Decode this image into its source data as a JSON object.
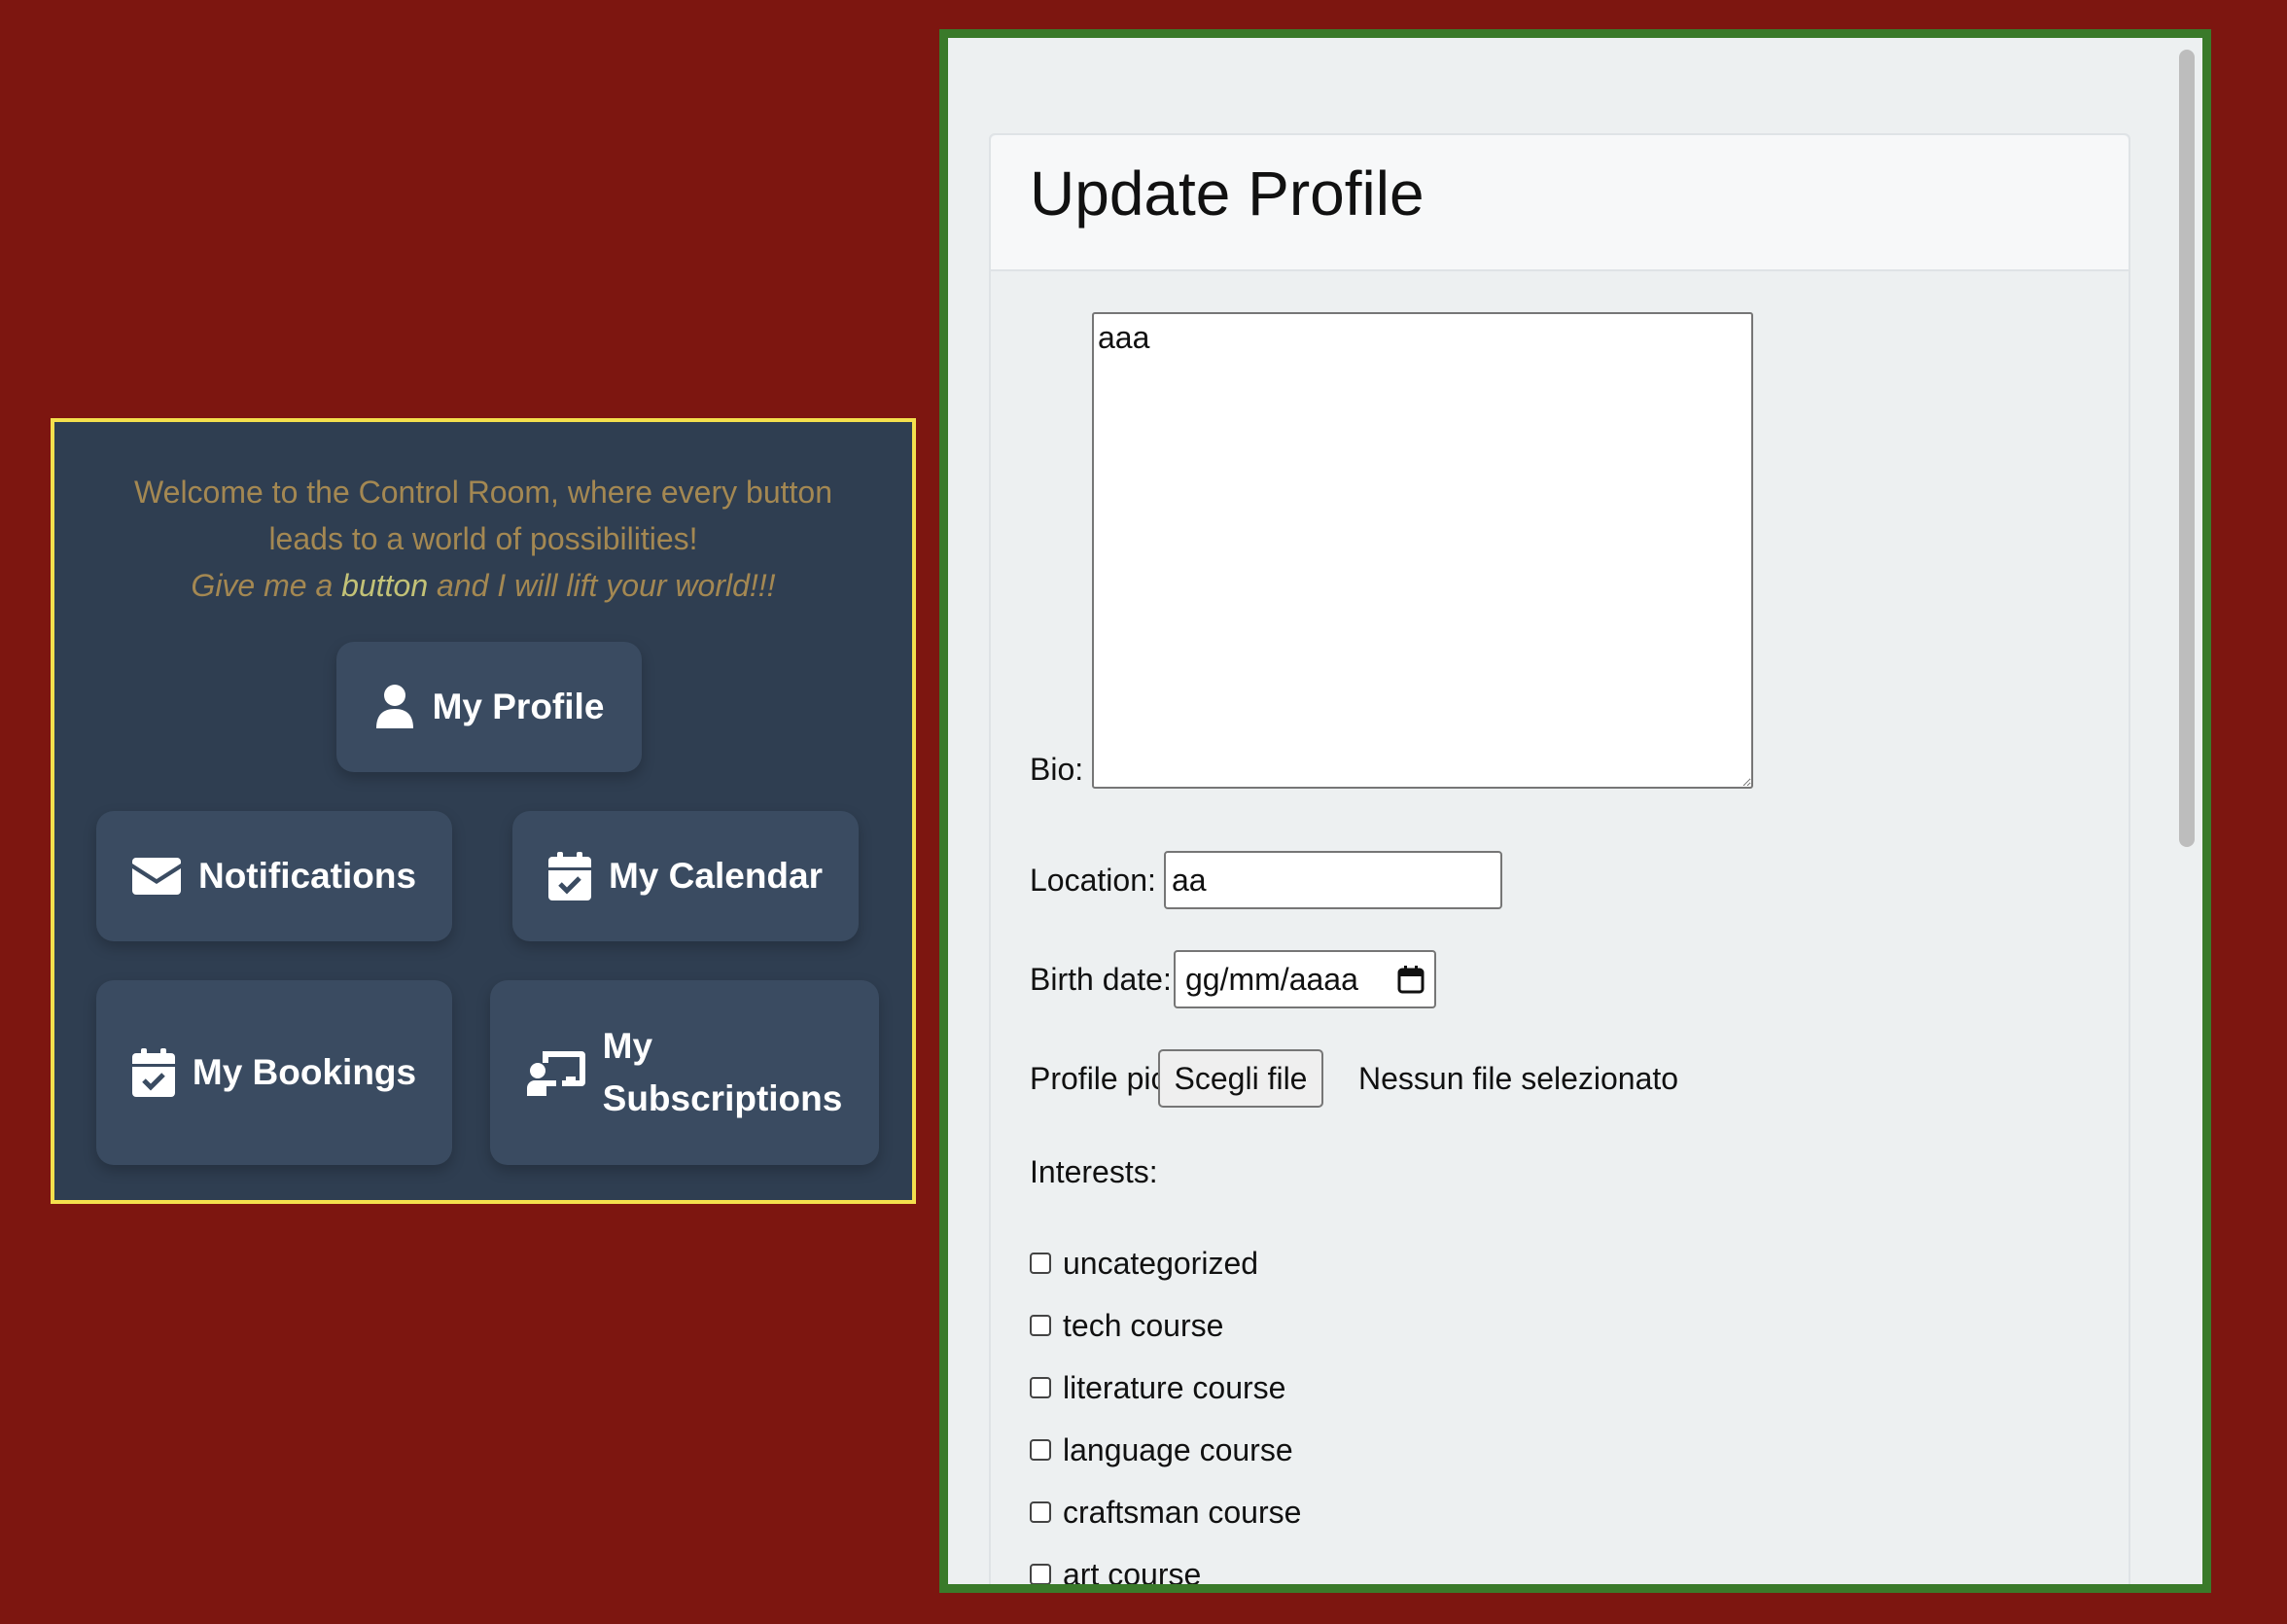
{
  "control_room": {
    "welcome_line1": "Welcome to the Control Room, where every button leads to a world of possibilities!",
    "welcome_line2_pre": "Give me a ",
    "welcome_line2_highlight": "button",
    "welcome_line2_post": " and I will lift your world!!!",
    "buttons": {
      "profile": "My Profile",
      "notifications": "Notifications",
      "calendar": "My Calendar",
      "bookings": "My Bookings",
      "subscriptions_line1": "My",
      "subscriptions_line2": "Subscriptions"
    }
  },
  "update_profile": {
    "title": "Update Profile",
    "bio_label": "Bio:",
    "bio_value": "aaa",
    "location_label": "Location:",
    "location_value": "aa",
    "birth_label": "Birth date:",
    "birth_placeholder": "gg/mm/aaaa",
    "pic_label": "Profile pic:",
    "file_button": "Scegli file",
    "file_status": "Nessun file selezionato",
    "interests_label": "Interests:",
    "interests": [
      "uncategorized",
      "tech course",
      "literature course",
      "language course",
      "craftsman course",
      "art course"
    ]
  },
  "colors": {
    "page_background": "#7d1610",
    "panel_background": "#2f3e51",
    "panel_border": "#f4e04d",
    "button_background": "#3a4b61",
    "welcome_text": "#a48852",
    "highlight_text": "#c3c277",
    "frame_border": "#3a7a2a"
  },
  "icons": {
    "profile": "user-icon",
    "notifications": "envelope-icon",
    "calendar": "calendar-check-icon",
    "bookings": "calendar-check-icon",
    "subscriptions": "chalkboard-teacher-icon",
    "birth_date": "calendar-icon"
  }
}
